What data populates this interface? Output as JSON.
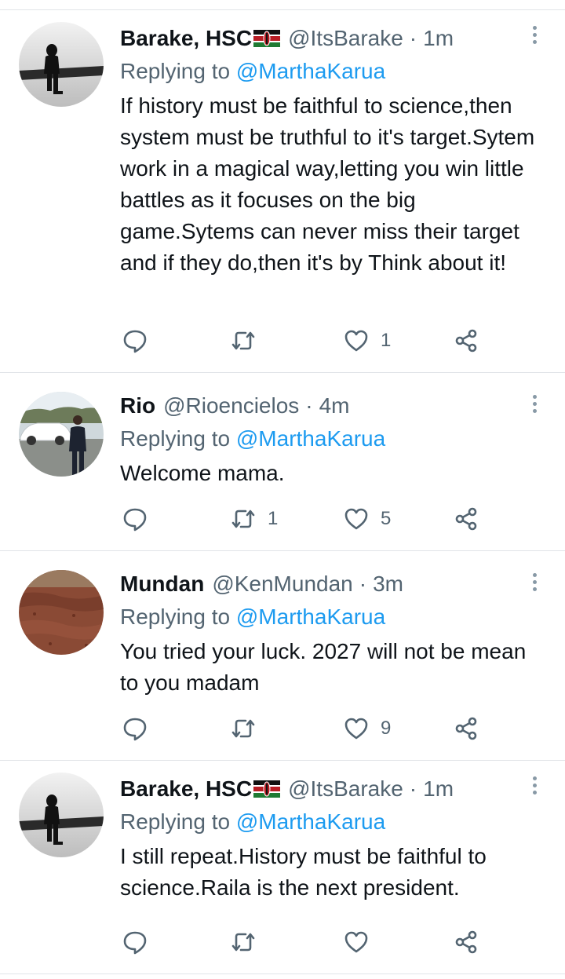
{
  "tweets": [
    {
      "name": "Barake, HSC",
      "handle": "@ItsBarake",
      "separator": "·",
      "time": "1m",
      "replying_prefix": "Replying to ",
      "replying_to": "@MarthaKarua",
      "text": "If history must be faithful to science,then system must be truthful to it's target.Sytem work in a magical way,letting you win little battles as it focuses on the big game.Sytems can never miss their target and if they do,then it's by  Think about it!",
      "retweets": "",
      "likes": "1",
      "avatar_icon": "person-sitting-avatar",
      "flag_icon": "kenya-flag-icon"
    },
    {
      "name": "Rio",
      "handle": "@Rioencielos",
      "separator": "·",
      "time": "4m",
      "replying_prefix": "Replying to ",
      "replying_to": "@MarthaKarua",
      "text": "Welcome mama.",
      "retweets": "1",
      "likes": "5",
      "avatar_icon": "man-with-car-avatar"
    },
    {
      "name": "Mundan",
      "handle": "@KenMundan",
      "separator": "·",
      "time": "3m",
      "replying_prefix": "Replying to ",
      "replying_to": "@MarthaKarua",
      "text": "You tried your  luck. 2027 will not be mean to you madam",
      "retweets": "",
      "likes": "9",
      "avatar_icon": "soil-field-avatar"
    },
    {
      "name": "Barake, HSC",
      "handle": "@ItsBarake",
      "separator": "·",
      "time": "1m",
      "replying_prefix": "Replying to ",
      "replying_to": "@MarthaKarua",
      "text": "I still repeat.History must be faithful to science.Raila is the next president.",
      "retweets": "",
      "likes": "",
      "avatar_icon": "person-sitting-avatar",
      "flag_icon": "kenya-flag-icon"
    }
  ],
  "colors": {
    "text": "#0f1419",
    "secondary": "#536471",
    "link": "#1d9bf0",
    "divider": "#e1e4e8",
    "icon": "#536471"
  }
}
